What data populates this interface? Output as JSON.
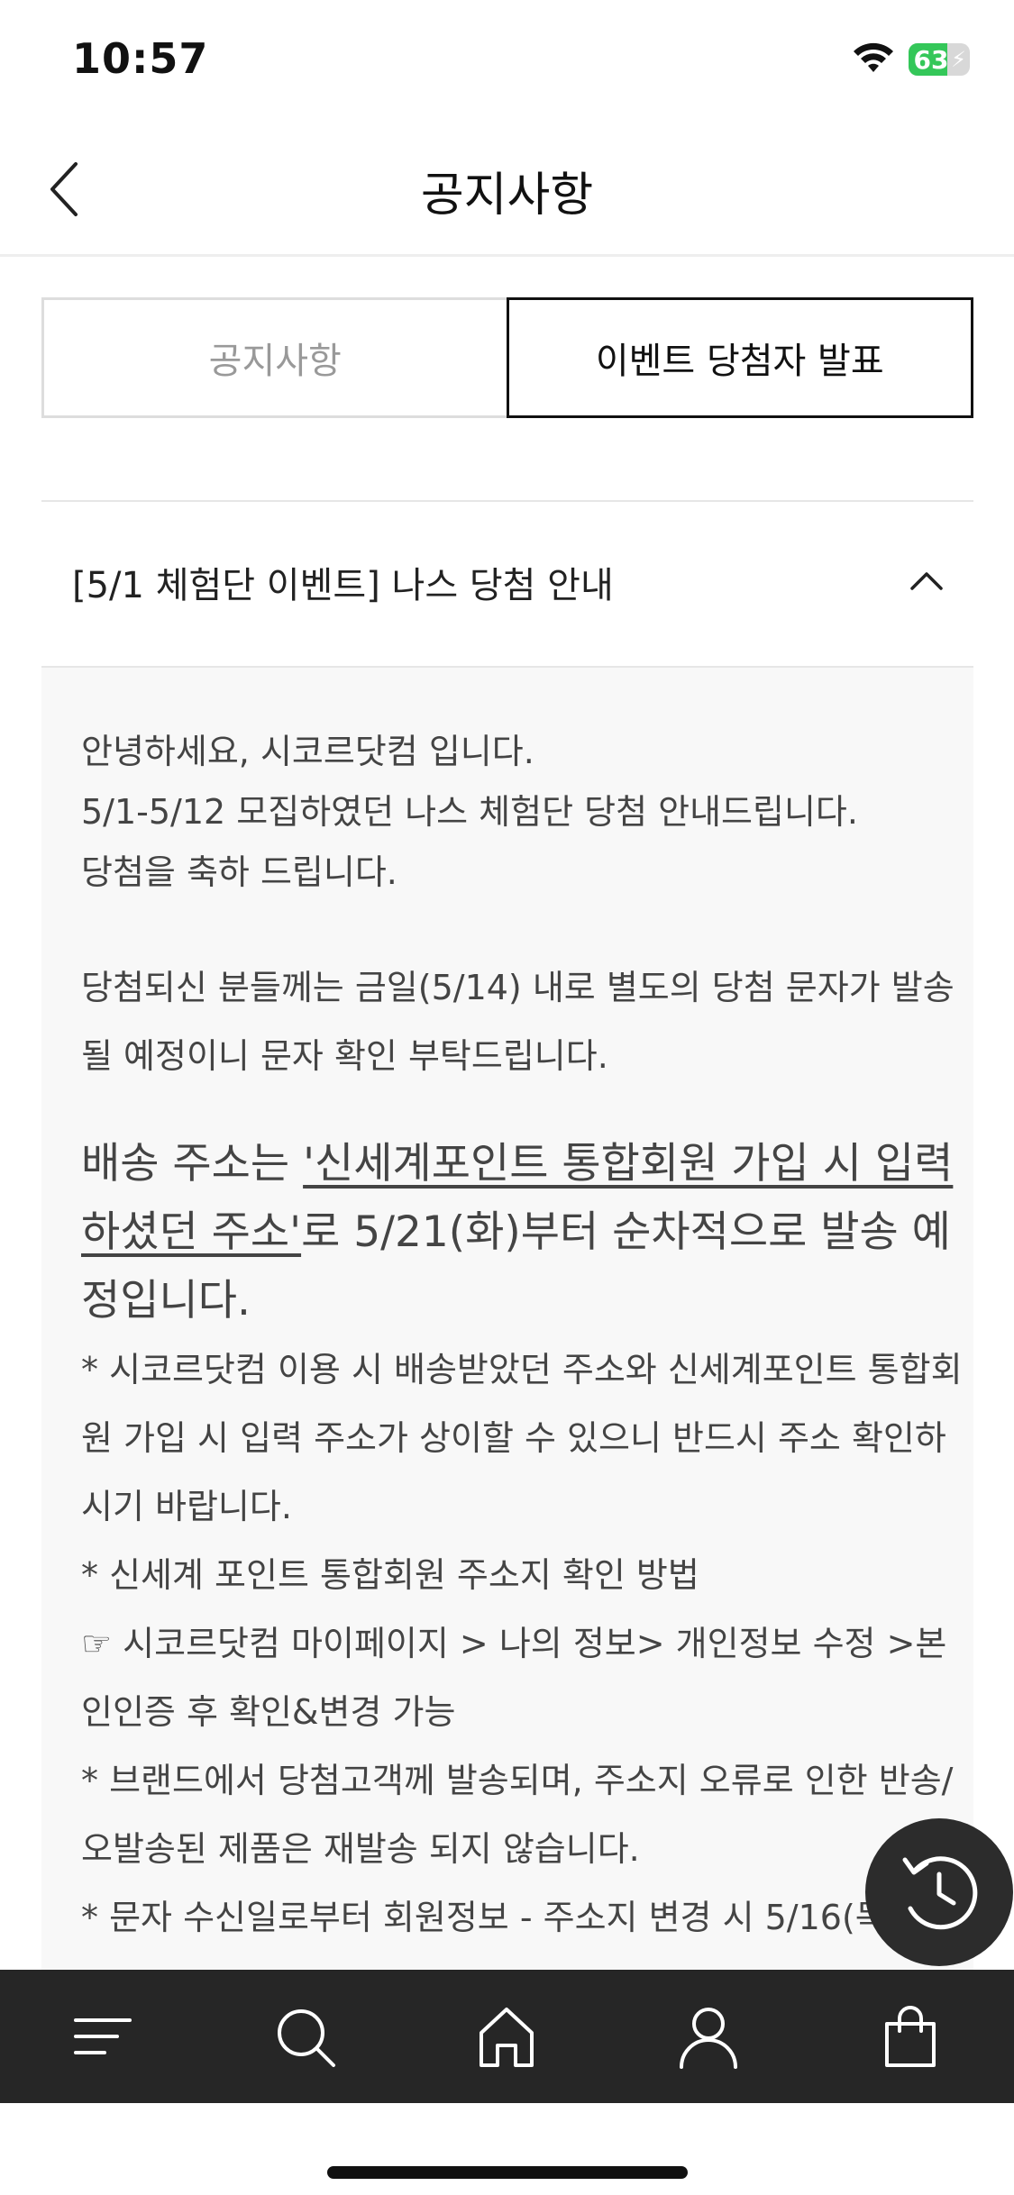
{
  "status_bar": {
    "time": "10:57",
    "battery": "63",
    "battery_level": 0.63
  },
  "header": {
    "title": "공지사항"
  },
  "tabs": [
    {
      "label": "공지사항",
      "active": false
    },
    {
      "label": "이벤트 당첨자 발표",
      "active": true
    }
  ],
  "notice": {
    "title": "[5/1 체험단 이벤트] 나스 당첨 안내",
    "para1": [
      "안녕하세요, 시코르닷컴 입니다.",
      "5/1-5/12 모집하였던 나스 체험단 당첨 안내드립니다.",
      "당첨을 축하 드립니다."
    ],
    "para2": "당첨되신 분들께는 금일(5/14) 내로 별도의 당첨 문자가 발송될 예정이니 문자 확인 부탁드립니다.",
    "para3": {
      "prefix": "배송 주소는 ",
      "underlined": "'신세계포인트 통합회원 가입 시 입력하셨던 주소'",
      "suffix": "로 5/21(화)부터 순차적으로 발송 예정입니다."
    },
    "para4": [
      "* 시코르닷컴 이용 시 배송받았던 주소와 신세계포인트 통합회원 가입 시 입력 주소가 상이할 수 있으니 반드시 주소 확인하시기 바랍니다.",
      "* 신세계 포인트 통합회원 주소지 확인 방법",
      "☞ 시코르닷컴 마이페이지 > 나의 정보> 개인정보 수정 >본인인증 후 확인&변경 가능",
      "* 브랜드에서 당첨고객께 발송되며, 주소지 오류로 인한 반송/오발송된 제품은 재발송 되지 않습니다.",
      "* 문자 수신일로부터 회원정보 - 주소지 변경 시 5/16(목)까"
    ]
  },
  "bottom_nav": {
    "items": [
      {
        "name": "menu",
        "icon": "menu-icon"
      },
      {
        "name": "search",
        "icon": "search-icon"
      },
      {
        "name": "home",
        "icon": "home-icon"
      },
      {
        "name": "my-page",
        "icon": "user-icon"
      },
      {
        "name": "cart",
        "icon": "shopping-bag-icon"
      }
    ]
  },
  "fab": {
    "icon": "history-icon"
  },
  "colors": {
    "accent": "#111111",
    "bottom_nav_bg": "#262626",
    "battery_green": "#34c759",
    "body_bg": "#f8f8f8"
  }
}
